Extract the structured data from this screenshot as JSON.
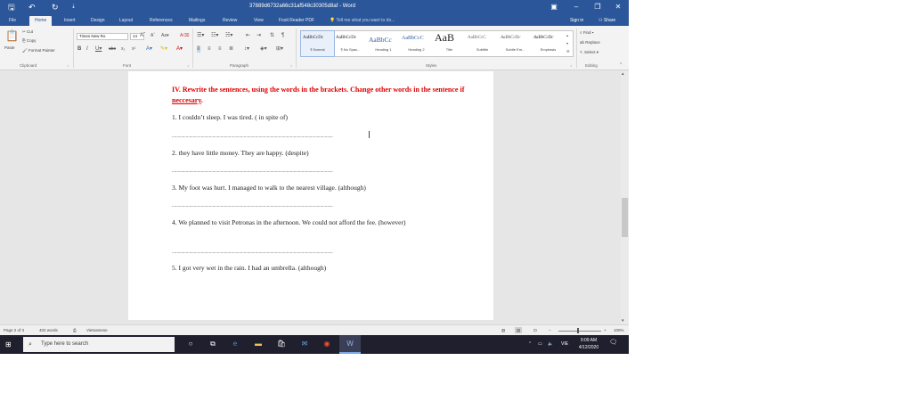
{
  "titlebar": {
    "doc_title": "37889d6732a66c31af548c30305d8af  -  Word",
    "save_icon": "save-icon",
    "undo_icon": "undo-icon",
    "redo_icon": "redo-icon",
    "minimize": "–",
    "restore": "❐",
    "close": "✕",
    "ribbon_display": "▣"
  },
  "tabs": {
    "items": [
      "File",
      "Home",
      "Insert",
      "Design",
      "Layout",
      "References",
      "Mailings",
      "Review",
      "View",
      "Foxit Reader PDF"
    ],
    "active": "Home",
    "tell_me": "Tell me what you want to do...",
    "sign_in": "Sign in",
    "share": "Share"
  },
  "ribbon": {
    "clipboard": {
      "paste": "Paste",
      "cut": "Cut",
      "copy": "Copy",
      "format_painter": "Format Painter",
      "label": "Clipboard"
    },
    "font": {
      "name": "Times New Ro",
      "size": "14",
      "label": "Font"
    },
    "paragraph": {
      "label": "Paragraph"
    },
    "styles": {
      "label": "Styles",
      "items": [
        {
          "sample": "AaBbCcDc",
          "name": "¶ Normal",
          "sample_size": 5
        },
        {
          "sample": "AaBbCcDc",
          "name": "¶ No Spac...",
          "sample_size": 5
        },
        {
          "sample": "AaBbCc",
          "name": "Heading 1",
          "sample_size": 7.5
        },
        {
          "sample": "AaBbCcC",
          "name": "Heading 2",
          "sample_size": 6
        },
        {
          "sample": "AaB",
          "name": "Title",
          "sample_size": 12
        },
        {
          "sample": "AaBbCcC",
          "name": "Subtitle",
          "sample_size": 5
        },
        {
          "sample": "AaBbCcDc",
          "name": "Subtle Em...",
          "sample_size": 5
        },
        {
          "sample": "AaBbCcDc",
          "name": "Emphasis",
          "sample_size": 5
        }
      ]
    },
    "editing": {
      "find": "Find",
      "replace": "Replace",
      "select": "Select",
      "label": "Editing"
    }
  },
  "document": {
    "heading_main": "IV. Rewrite the sentences, using the words in the brackets. Change other words in the sentence if ",
    "heading_underlined": "neccesary",
    "heading_end": ".",
    "questions": [
      "1. I couldn’t sleep. I was tired. ( in spite of)",
      "2. they have little money. They are happy. (despite)",
      "3. My foot was hurt. I managed to walk to the nearest village. (although)",
      "4. We planned to visit Petronas in the afternoon. We could not afford the fee. (however)",
      "5. I got very wet in the rain. I had an umbrella. (although)"
    ],
    "answer_line": "..........................................................................................................................................."
  },
  "statusbar": {
    "page": "Page 2 of 3",
    "words": "402 words",
    "language": "Vietnamese",
    "zoom": "100%",
    "zoom_minus": "–",
    "zoom_plus": "+"
  },
  "taskbar": {
    "search_placeholder": "Type here to search",
    "time": "9:09 AM",
    "date": "4/12/2020",
    "lang": "VIE"
  }
}
